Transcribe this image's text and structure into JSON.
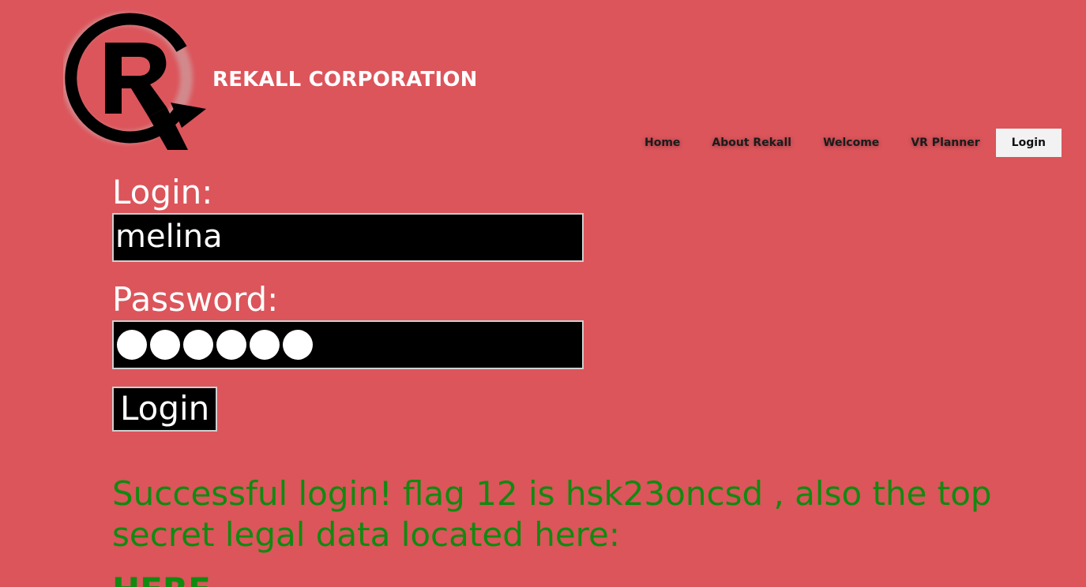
{
  "header": {
    "brand": "REKALL CORPORATION",
    "logo_icon": "rekall-registered-r-logo"
  },
  "nav": {
    "items": [
      {
        "label": "Home"
      },
      {
        "label": "About Rekall"
      },
      {
        "label": "Welcome"
      },
      {
        "label": "VR Planner"
      },
      {
        "label": "Login",
        "active": true
      }
    ]
  },
  "form": {
    "login_label": "Login:",
    "login_value": "melina",
    "password_label": "Password:",
    "password_masked_count": 6,
    "submit_label": "Login"
  },
  "message": {
    "text": "Successful login! flag 12 is hsk23oncsd , also the top secret legal data located here:",
    "link_label": "HERE"
  },
  "colors": {
    "background": "#db555b",
    "message": "#108a10",
    "field_bg": "#000000"
  }
}
